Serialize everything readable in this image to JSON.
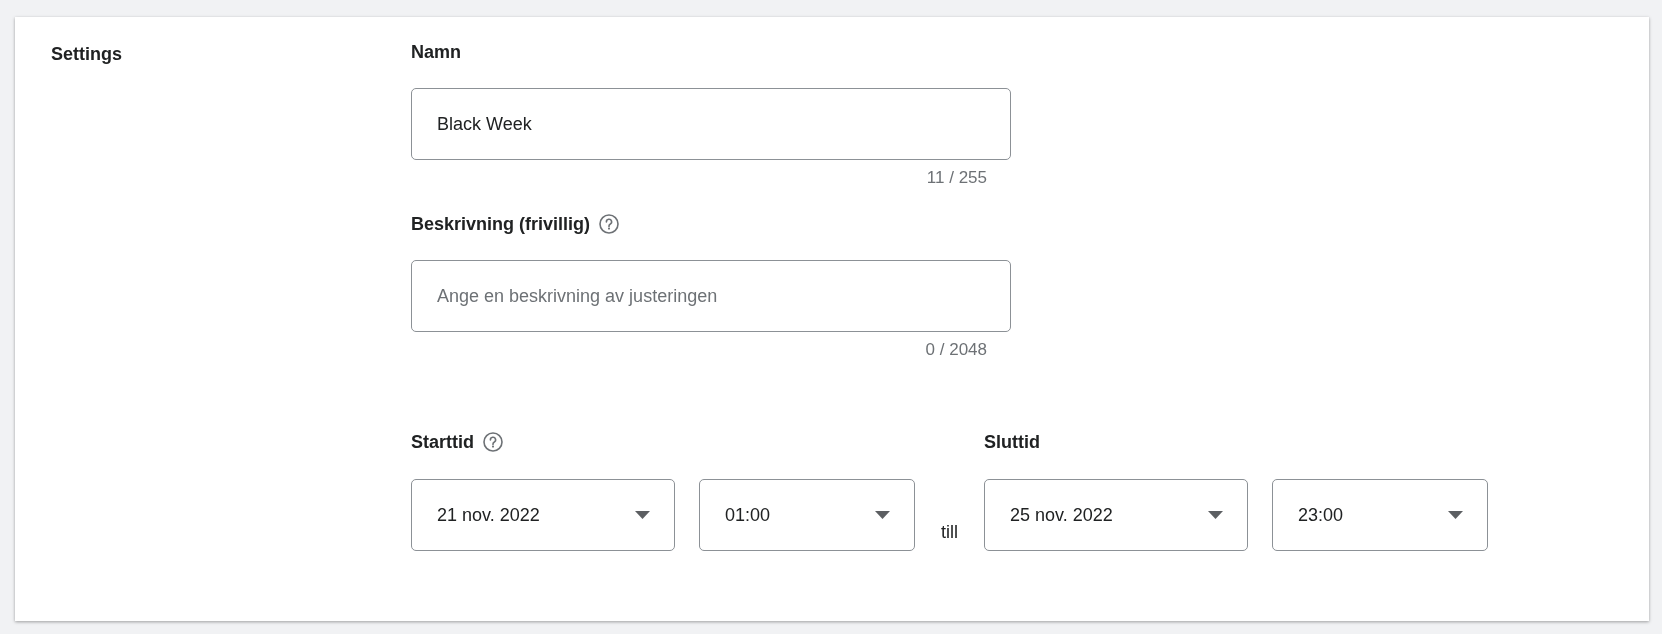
{
  "section": {
    "title": "Settings"
  },
  "fields": [
    {
      "label": "Namn",
      "help": false,
      "value": "Black Week",
      "counter": "11 / 255"
    },
    {
      "label": "Beskrivning (frivillig)",
      "help": true,
      "placeholder": "Ange en beskrivning av justeringen",
      "counter": "0 / 2048"
    }
  ],
  "schedule": {
    "start": {
      "label": "Starttid",
      "help": true,
      "date": "21 nov. 2022",
      "time": "01:00"
    },
    "separator": "till",
    "end": {
      "label": "Sluttid",
      "help": false,
      "date": "25 nov. 2022",
      "time": "23:00"
    }
  }
}
